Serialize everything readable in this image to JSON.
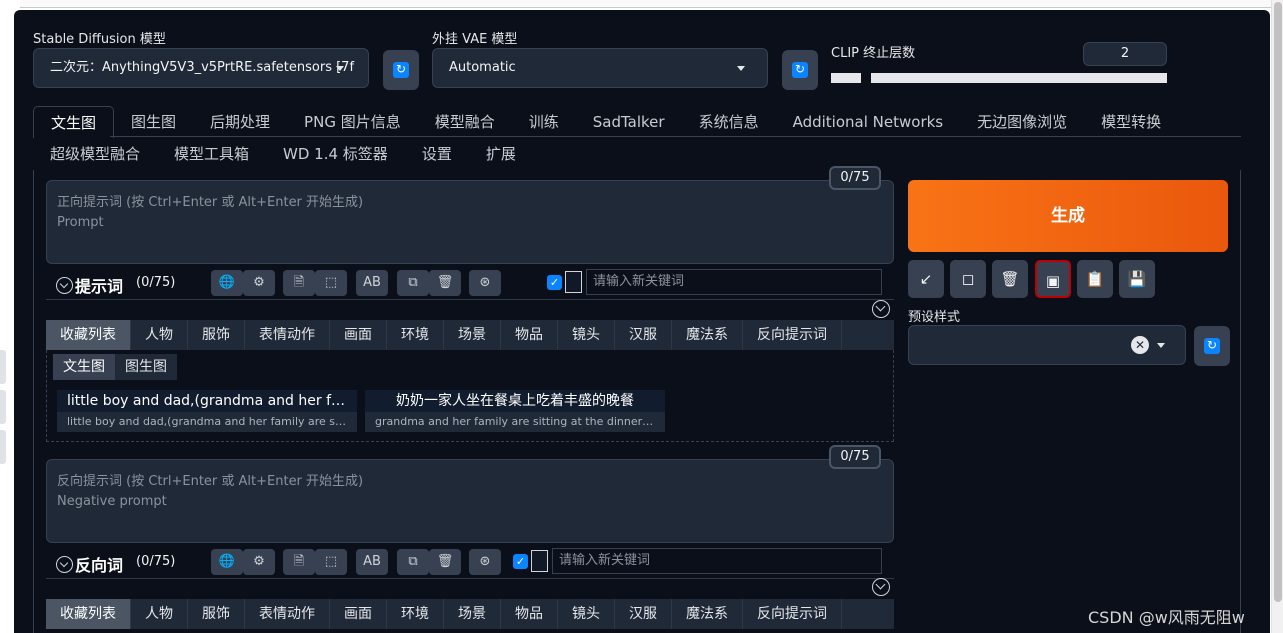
{
  "models": {
    "sd_label": "Stable Diffusion 模型",
    "sd_value": "二次元：AnythingV5V3_v5PrtRE.safetensors [7f",
    "vae_label": "外挂 VAE 模型",
    "vae_value": "Automatic",
    "clip_label": "CLIP 终止层数",
    "clip_value": "2",
    "refresh_icon": "↻"
  },
  "tabs_row1": [
    "文生图",
    "图生图",
    "后期处理",
    "PNG 图片信息",
    "模型融合",
    "训练",
    "SadTalker",
    "系统信息",
    "Additional Networks",
    "无边图像浏览",
    "模型转换"
  ],
  "tabs_row2": [
    "超级模型融合",
    "模型工具箱",
    "WD 1.4 标签器",
    "设置",
    "扩展"
  ],
  "positive": {
    "placeholder_line1": "正向提示词 (按 Ctrl+Enter 或 Alt+Enter 开始生成)",
    "placeholder_line2": "Prompt",
    "counter": "0/75",
    "toolbar_title": "提示词",
    "toolbar_count": "(0/75)",
    "keyword_placeholder": "请输入新关键词"
  },
  "negative": {
    "placeholder_line1": "反向提示词 (按 Ctrl+Enter 或 Alt+Enter 开始生成)",
    "placeholder_line2": "Negative prompt",
    "counter": "0/75",
    "toolbar_title": "反向词",
    "toolbar_count": "(0/75)",
    "keyword_placeholder": "请输入新关键词"
  },
  "toolbar_icons": [
    "🌐",
    "⚙",
    "🗎",
    "⬚",
    "AB",
    "⧉",
    "🗑",
    "⊛"
  ],
  "categories": [
    "收藏列表",
    "人物",
    "服饰",
    "表情动作",
    "画面",
    "环境",
    "场景",
    "物品",
    "镜头",
    "汉服",
    "魔法系",
    "反向提示词"
  ],
  "favorites": {
    "subtabs": [
      "文生图",
      "图生图"
    ],
    "cards": [
      {
        "title": "little boy and dad,(grandma and her family are sitting at the dinner table",
        "subtitle": "little boy and dad,(grandma and her family are sitting at the dinner table"
      },
      {
        "title": "奶奶一家人坐在餐桌上吃着丰盛的晚餐",
        "subtitle": "grandma and her family are sitting at the dinner table enjoying"
      }
    ]
  },
  "side": {
    "generate_label": "生成",
    "tool_icons": [
      "↙",
      "◻",
      "🗑",
      "▣",
      "📋",
      "💾"
    ],
    "styles_label": "预设样式",
    "clear_icon": "✕"
  },
  "watermark": "CSDN @w风雨无阻w"
}
